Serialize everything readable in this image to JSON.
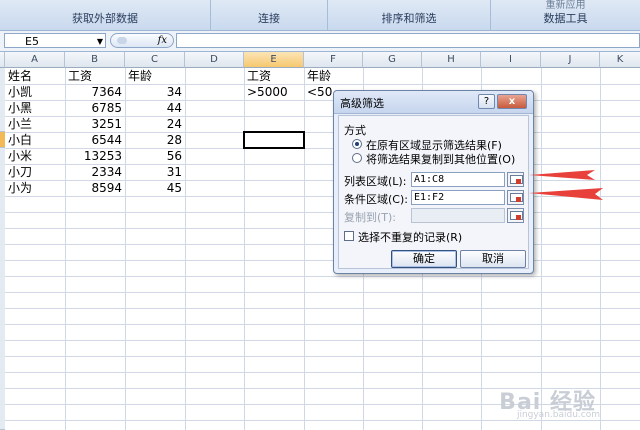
{
  "ribbon": {
    "groups": [
      {
        "label": "获取外部数据",
        "top": ""
      },
      {
        "label": "连接",
        "top": ""
      },
      {
        "label": "排序和筛选",
        "top": ""
      },
      {
        "label": "数据工具",
        "top": "重新应用"
      }
    ]
  },
  "formula_bar": {
    "name_box": "E5",
    "fx": "fx",
    "value": ""
  },
  "columns": [
    "A",
    "B",
    "C",
    "D",
    "E",
    "F",
    "G",
    "H",
    "I",
    "J",
    "K"
  ],
  "selected_column": "E",
  "sheet": {
    "headers": {
      "a": "姓名",
      "b": "工资",
      "c": "年龄"
    },
    "rows": [
      {
        "name": "小凯",
        "salary": "7364",
        "age": "34"
      },
      {
        "name": "小黑",
        "salary": "6785",
        "age": "44"
      },
      {
        "name": "小兰",
        "salary": "3251",
        "age": "24"
      },
      {
        "name": "小白",
        "salary": "6544",
        "age": "28"
      },
      {
        "name": "小米",
        "salary": "13253",
        "age": "56"
      },
      {
        "name": "小刀",
        "salary": "2334",
        "age": "31"
      },
      {
        "name": "小为",
        "salary": "8594",
        "age": "45"
      }
    ],
    "criteria": {
      "e1": "工资",
      "f1": "年龄",
      "e2": ">5000",
      "f2": "<50"
    }
  },
  "dialog": {
    "title": "高级筛选",
    "help_btn": "?",
    "close_btn": "x",
    "section_label": "方式",
    "option1": "在原有区域显示筛选结果(F)",
    "option2": "将筛选结果复制到其他位置(O)",
    "list_range_label": "列表区域(L):",
    "list_range_value": "A1:C8",
    "criteria_range_label": "条件区域(C):",
    "criteria_range_value": "E1:F2",
    "copy_to_label": "复制到(T):",
    "copy_to_value": "",
    "unique_label": "选择不重复的记录(R)",
    "ok": "确定",
    "cancel": "取消",
    "annotation_color": "#e8403a"
  },
  "watermark": {
    "text": "Bai 经验",
    "sub": "jingyan.baidu.com"
  }
}
